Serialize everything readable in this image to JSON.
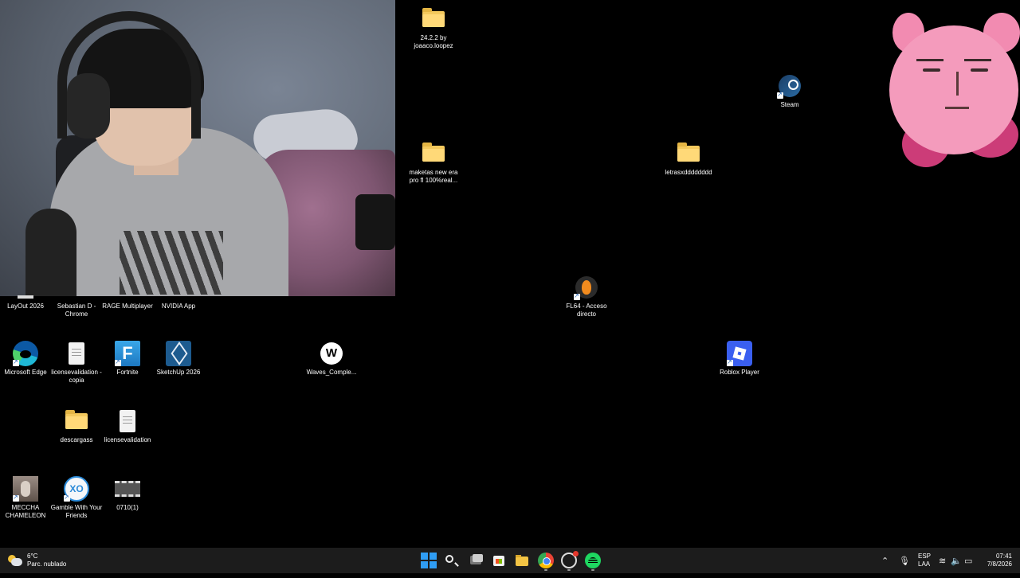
{
  "desktop": {
    "icons": [
      {
        "id": "folder-2422",
        "label": "24.2.2 by joaaco.loopez"
      },
      {
        "id": "steam",
        "label": "Steam"
      },
      {
        "id": "maketas",
        "label": "maketas new era pro fl 100%real..."
      },
      {
        "id": "letras",
        "label": "letrasxdddddddd"
      },
      {
        "id": "fl64",
        "label": "FL64 - Acceso directo"
      },
      {
        "id": "layout",
        "label": "LayOut 2026"
      },
      {
        "id": "sebastian",
        "label": "Sebastian D - Chrome"
      },
      {
        "id": "rage",
        "label": "RAGE Multiplayer"
      },
      {
        "id": "nvidia",
        "label": "NVIDIA App"
      },
      {
        "id": "edge",
        "label": "Microsoft Edge"
      },
      {
        "id": "license-copia",
        "label": "licensevalidation - copia"
      },
      {
        "id": "fortnite",
        "label": "Fortnite"
      },
      {
        "id": "sketchup",
        "label": "SketchUp 2026"
      },
      {
        "id": "waves",
        "label": "Waves_Comple..."
      },
      {
        "id": "roblox",
        "label": "Roblox Player"
      },
      {
        "id": "descargass",
        "label": "descargass"
      },
      {
        "id": "license",
        "label": "licensevalidation"
      },
      {
        "id": "meccha",
        "label": "MECCHA CHAMELEON"
      },
      {
        "id": "gamble",
        "label": "Gamble With Your Friends"
      },
      {
        "id": "video",
        "label": "0710(1)"
      }
    ]
  },
  "taskbar": {
    "weather": {
      "temp": "6°C",
      "condition": "Parc. nublado"
    },
    "apps": [
      "start",
      "search",
      "task-view",
      "microsoft-store",
      "file-explorer",
      "chrome",
      "obs",
      "spotify"
    ],
    "tray": {
      "lang_top": "ESP",
      "lang_bottom": "LAA"
    },
    "clock": {
      "time": "07:41",
      "date": "7/8/2026"
    }
  },
  "colors": {
    "desktop_bg": "#000000",
    "taskbar_bg": "#1c1c1c",
    "folder": "#f4c95d",
    "windows_blue": "#2f9df4"
  }
}
